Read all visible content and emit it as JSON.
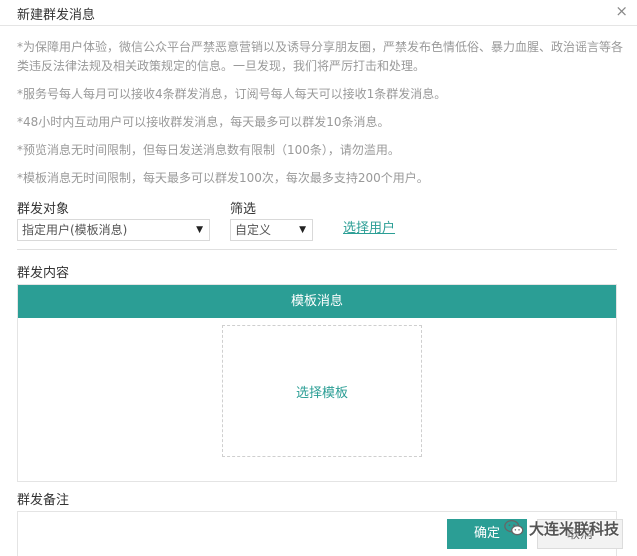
{
  "dialog": {
    "title": "新建群发消息",
    "close_glyph": "×"
  },
  "notices": [
    "*为保障用户体验，微信公众平台严禁恶意营销以及诱导分享朋友圈，严禁发布色情低俗、暴力血腥、政治谣言等各类违反法律法规及相关政策规定的信息。一旦发现，我们将严厉打击和处理。",
    "*服务号每人每月可以接收4条群发消息，订阅号每人每天可以接收1条群发消息。",
    "*48小时内互动用户可以接收群发消息，每天最多可以群发10条消息。",
    "*预览消息无时间限制，但每日发送消息数有限制（100条），请勿滥用。",
    "*模板消息无时间限制，每天最多可以群发100次，每次最多支持200个用户。"
  ],
  "target": {
    "label": "群发对象",
    "selected": "指定用户(模板消息)"
  },
  "filter": {
    "label": "筛选",
    "selected": "自定义"
  },
  "select_user_link": "选择用户",
  "content": {
    "label": "群发内容",
    "tab_label": "模板消息",
    "picker_label": "选择模板"
  },
  "remark": {
    "label": "群发备注"
  },
  "buttons": {
    "confirm": "确定",
    "cancel": "取消"
  },
  "watermark": {
    "text": "大连米联科技"
  },
  "colors": {
    "accent": "#2b9e95"
  }
}
